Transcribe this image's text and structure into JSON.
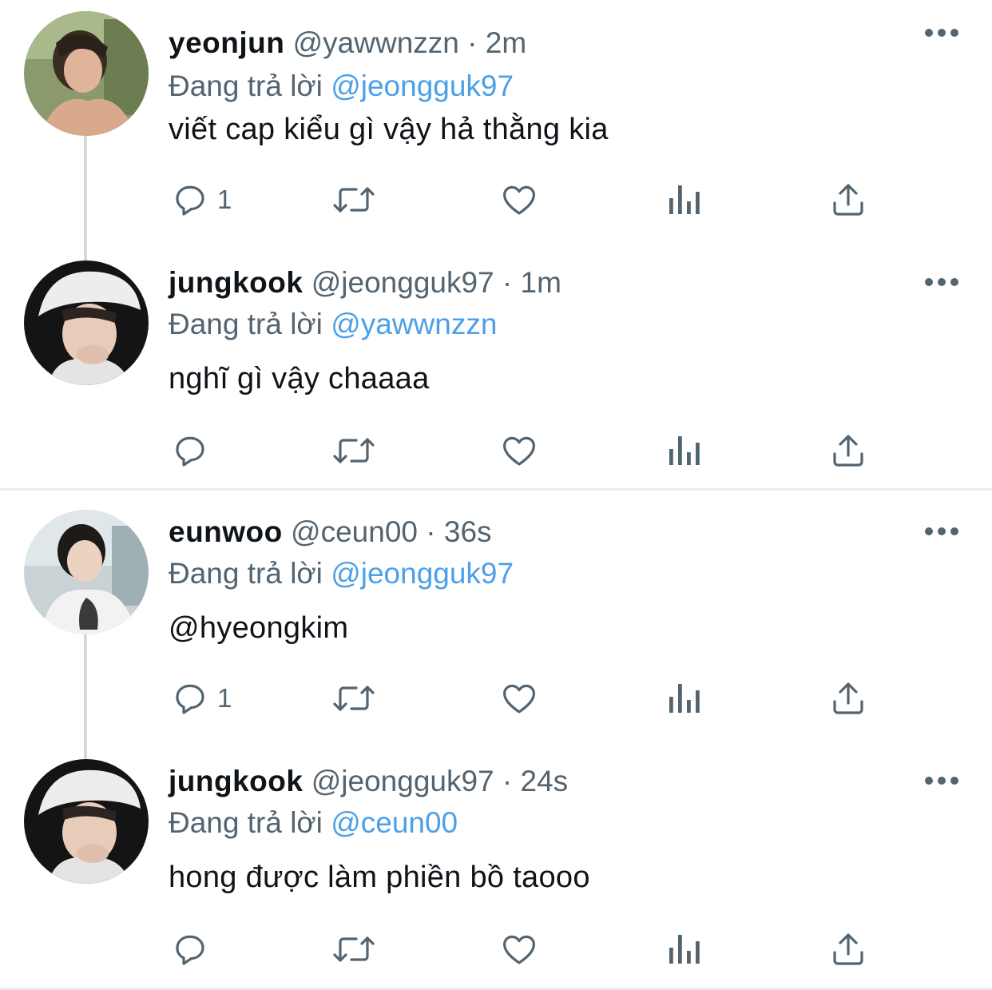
{
  "tweets": [
    {
      "name": "yeonjun",
      "handle": "@yawwnzzn",
      "time": "2m",
      "replying_label": "Đang trả lời",
      "replying_to": "@jeongguk97",
      "text": "viết cap kiểu gì vậy hả thằng kia",
      "reply_count": "1"
    },
    {
      "name": "jungkook",
      "handle": "@jeongguk97",
      "time": "1m",
      "replying_label": "Đang trả lời",
      "replying_to": "@yawwnzzn",
      "text": "nghĩ gì vậy chaaaa",
      "reply_count": ""
    },
    {
      "name": "eunwoo",
      "handle": "@ceun00",
      "time": "36s",
      "replying_label": "Đang trả lời",
      "replying_to": "@jeongguk97",
      "text": "@hyeongkim",
      "reply_count": "1"
    },
    {
      "name": "jungkook",
      "handle": "@jeongguk97",
      "time": "24s",
      "replying_label": "Đang trả lời",
      "replying_to": "@ceun00",
      "text": "hong được làm phiền bồ taooo",
      "reply_count": ""
    }
  ],
  "separator": "·",
  "icons": {
    "reply": "reply-icon",
    "retweet": "retweet-icon",
    "like": "heart-icon",
    "views": "analytics-icon",
    "share": "share-icon",
    "more": "more-icon"
  },
  "colors": {
    "link": "#4da0e8",
    "secondary_text": "#536471",
    "connector": "#cfd9de",
    "divider": "#e6ecf0"
  }
}
